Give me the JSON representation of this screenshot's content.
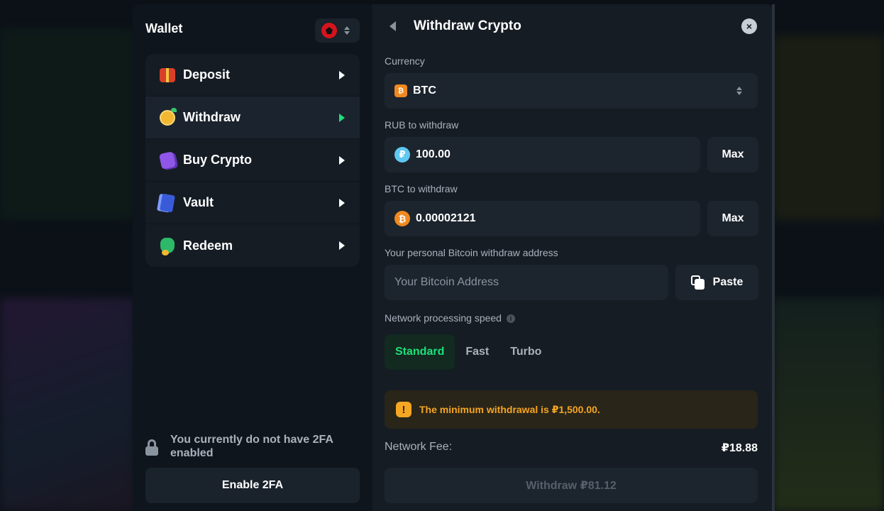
{
  "sidebar": {
    "title": "Wallet",
    "items": [
      {
        "label": "Deposit",
        "icon": "gift-icon",
        "active": false
      },
      {
        "label": "Withdraw",
        "icon": "coin-icon",
        "active": true
      },
      {
        "label": "Buy Crypto",
        "icon": "crypto-card-icon",
        "active": false
      },
      {
        "label": "Vault",
        "icon": "vault-cards-icon",
        "active": false
      },
      {
        "label": "Redeem",
        "icon": "money-bag-icon",
        "active": false
      }
    ],
    "twofa_notice": "You currently do not have 2FA enabled",
    "enable_2fa_label": "Enable 2FA"
  },
  "panel": {
    "title": "Withdraw Crypto",
    "currency_label": "Currency",
    "currency_value": "BTC",
    "rub_label": "RUB to withdraw",
    "rub_symbol": "₽",
    "rub_value": "100.00",
    "btc_label": "BTC to withdraw",
    "btc_symbol": "₿",
    "btc_value": "0.00002121",
    "max_label": "Max",
    "address_label": "Your personal Bitcoin withdraw address",
    "address_placeholder": "Your Bitcoin Address",
    "paste_label": "Paste",
    "speed_label": "Network processing speed",
    "speeds": [
      "Standard",
      "Fast",
      "Turbo"
    ],
    "selected_speed": "Standard",
    "warning_text": "The minimum withdrawal is ₽1,500.00.",
    "fee_label": "Network Fee:",
    "fee_value": "₽18.88",
    "withdraw_button": "Withdraw ₽81.12"
  },
  "colors": {
    "accent_green": "#1fe07a",
    "warning_orange": "#f5a623",
    "btc_orange": "#f0891f",
    "rub_blue": "#5ec8f2"
  }
}
